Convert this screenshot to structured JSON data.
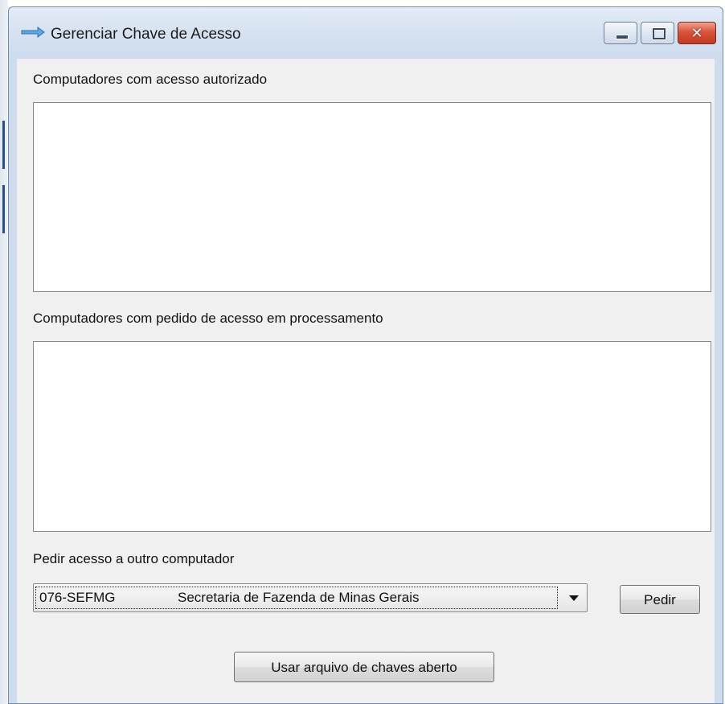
{
  "window": {
    "title": "Gerenciar Chave de Acesso",
    "icon": "arrow-icon"
  },
  "labels": {
    "authorized": "Computadores com acesso autorizado",
    "pending": "Computadores com pedido de acesso em processamento",
    "request_other": "Pedir acesso a outro computador"
  },
  "authorized_list": [],
  "pending_list": [],
  "computer_select": {
    "code": "076-SEFMG",
    "name": "Secretaria de Fazenda de Minas Gerais"
  },
  "buttons": {
    "request": "Pedir",
    "use_keyfile": "Usar arquivo de chaves aberto"
  },
  "colors": {
    "titlebar": "#d6e2f0",
    "close_button": "#c23a22",
    "client_bg": "#f0f0f0"
  }
}
